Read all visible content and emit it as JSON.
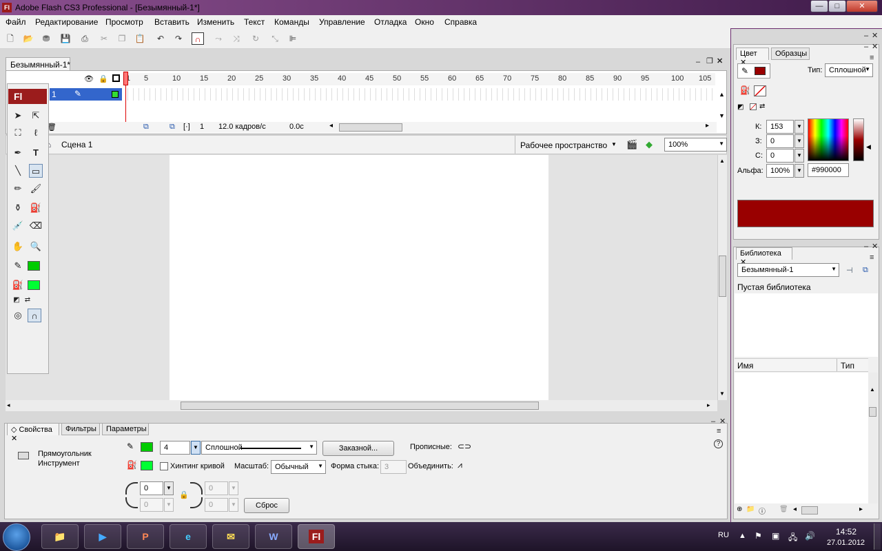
{
  "window": {
    "title": "Adobe Flash CS3 Professional - [Безымянный-1*]",
    "app_icon": "Fl",
    "min_label": "—",
    "max_label": "□",
    "close_label": "✕"
  },
  "menu": [
    "Файл",
    "Редактирование",
    "Просмотр",
    "Вставить",
    "Изменить",
    "Текст",
    "Команды",
    "Управление",
    "Отладка",
    "Окно",
    "Справка"
  ],
  "document": {
    "tab_label": "Безымянный-1*"
  },
  "timeline": {
    "ruler_ticks": [
      "1",
      "5",
      "10",
      "15",
      "20",
      "25",
      "30",
      "35",
      "40",
      "45",
      "50",
      "55",
      "60",
      "65",
      "70",
      "75",
      "80",
      "85",
      "90",
      "95",
      "100",
      "105"
    ],
    "layer_name": "1",
    "current_frame": "1",
    "fps": "12.0 кадров/с",
    "elapsed": "0.0с"
  },
  "scene": {
    "name": "Сцена 1",
    "workspace_label": "Рабочее пространство",
    "zoom": "100%"
  },
  "tools": {
    "badge": "Fl",
    "stroke_color": "#00cc00",
    "fill_color": "#00ff33"
  },
  "properties": {
    "tabs": [
      "Свойства",
      "Фильтры",
      "Параметры"
    ],
    "tool_title": "Прямоугольник",
    "tool_subtitle": "Инструмент",
    "stroke_height": "4",
    "stroke_style": "Сплошной",
    "custom_button": "Заказной...",
    "caps_label": "Прописные:",
    "hinting_label": "Хинтинг кривой",
    "scale_label": "Масштаб:",
    "scale_value": "Обычный",
    "miter_label": "Форма стыка:",
    "miter_value": "3",
    "join_label": "Объединить:",
    "corner_tl": "0",
    "corner_bl": "0",
    "corner_tr": "0",
    "corner_br": "0",
    "reset_button": "Сброс",
    "stroke_color": "#00cc00",
    "fill_color": "#00ff33"
  },
  "color_panel": {
    "tabs": [
      "Цвет",
      "Образцы"
    ],
    "type_label": "Тип:",
    "type_value": "Сплошной",
    "r_label": "К:",
    "r_value": "153",
    "g_label": "З:",
    "g_value": "0",
    "b_label": "С:",
    "b_value": "0",
    "alpha_label": "Альфа:",
    "alpha_value": "100%",
    "hex_value": "#990000",
    "current_color": "#990000"
  },
  "library": {
    "tab": "Библиотека",
    "doc_select": "Безымянный-1",
    "empty_text": "Пустая библиотека",
    "col_name": "Имя",
    "col_type": "Тип"
  },
  "taskbar": {
    "apps": [
      "explorer",
      "media-player",
      "powerpoint",
      "internet-explorer",
      "outlook",
      "word",
      "Fl"
    ],
    "lang": "RU",
    "time": "14:52",
    "date": "27.01.2012"
  }
}
